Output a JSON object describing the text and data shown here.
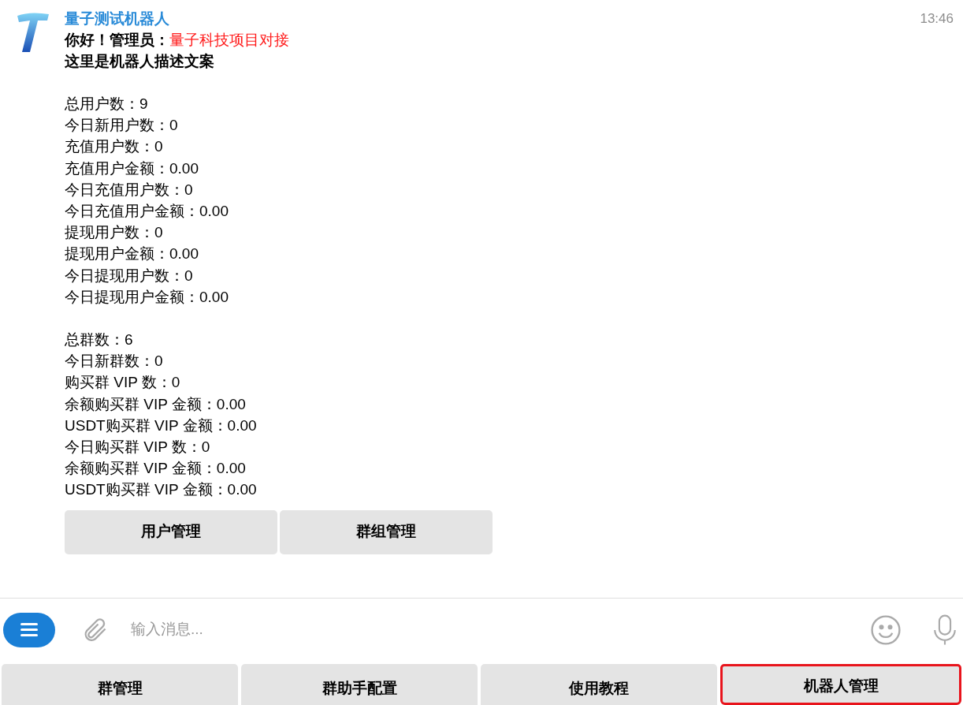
{
  "message": {
    "sender": "量子测试机器人",
    "time": "13:46",
    "greeting": "你好！管理员：",
    "admin_name": "量子科技项目对接",
    "description": "这里是机器人描述文案",
    "stat_groups": [
      [
        "总用户数：9",
        "今日新用户数：0",
        "充值用户数：0",
        "充值用户金额：0.00",
        "今日充值用户数：0",
        "今日充值用户金额：0.00",
        "提现用户数：0",
        "提现用户金额：0.00",
        "今日提现用户数：0",
        "今日提现用户金额：0.00"
      ],
      [
        "总群数：6",
        "今日新群数：0",
        "购买群 VIP 数：0",
        "余额购买群 VIP 金额：0.00",
        "USDT购买群 VIP 金额：0.00",
        "今日购买群 VIP 数：0",
        "余额购买群 VIP 金额：0.00",
        "USDT购买群 VIP 金额：0.00"
      ]
    ],
    "inline_buttons": [
      "用户管理",
      "群组管理"
    ]
  },
  "composer": {
    "placeholder": "输入消息..."
  },
  "keyboard": [
    {
      "label": "群管理",
      "highlighted": false
    },
    {
      "label": "群助手配置",
      "highlighted": false
    },
    {
      "label": "使用教程",
      "highlighted": false
    },
    {
      "label": "机器人管理",
      "highlighted": true
    }
  ]
}
